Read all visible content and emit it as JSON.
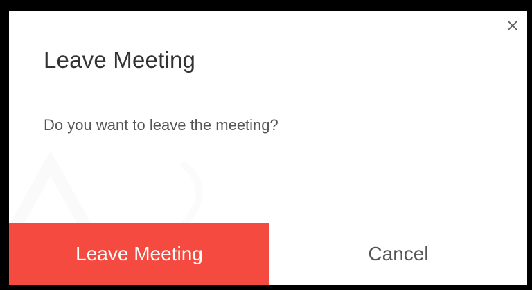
{
  "dialog": {
    "title": "Leave Meeting",
    "message": "Do you want to leave the meeting?",
    "close_icon": "close-icon",
    "buttons": {
      "leave_label": "Leave Meeting",
      "cancel_label": "Cancel"
    }
  },
  "colors": {
    "primary_action": "#f44a3f",
    "backdrop": "#000000",
    "dialog_background": "#ffffff"
  }
}
